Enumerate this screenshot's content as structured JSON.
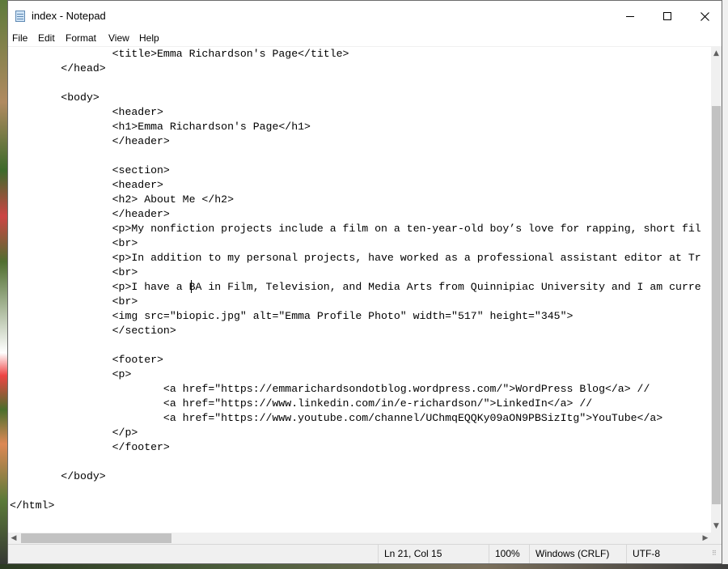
{
  "window": {
    "title": "index - Notepad"
  },
  "menu": [
    "File",
    "Edit",
    "Format",
    "View",
    "Help"
  ],
  "editor": {
    "lines": [
      "\t\t<title>Emma Richardson's Page</title>",
      "\t</head>",
      "",
      "\t<body>",
      "\t\t<header>",
      "\t\t<h1>Emma Richardson's Page</h1>",
      "\t\t</header>",
      "",
      "\t\t<section>",
      "\t\t<header>",
      "\t\t<h2> About Me </h2>",
      "\t\t</header>",
      "\t\t<p>My nonfiction projects include a film on a ten-year-old boy’s love for rapping, short fil",
      "\t\t<br>",
      "\t\t<p>In addition to my personal projects, have worked as a professional assistant editor at Tr",
      "\t\t<br>",
      "\t\t<p>I have a BA in Film, Television, and Media Arts from Quinnipiac University and I am curre",
      "\t\t<br>",
      "\t\t<img src=\"biopic.jpg\" alt=\"Emma Profile Photo\" width=\"517\" height=\"345\">",
      "\t\t</section>",
      "",
      "\t\t<footer>",
      "\t\t<p>",
      "\t\t\t<a href=\"https://emmarichardsondotblog.wordpress.com/\">WordPress Blog</a> //",
      "\t\t\t<a href=\"https://www.linkedin.com/in/e-richardson/\">LinkedIn</a> //",
      "\t\t\t<a href=\"https://www.youtube.com/channel/UChmqEQQKy09aON9PBSizItg\">YouTube</a>",
      "\t\t</p>",
      "\t\t</footer>",
      "",
      "\t</body>",
      "",
      "</html>"
    ]
  },
  "status": {
    "position": "Ln 21, Col 15",
    "zoom": "100%",
    "line_endings": "Windows (CRLF)",
    "encoding": "UTF-8"
  },
  "icons": {
    "app": "notepad-icon",
    "minimize": "minimize-icon",
    "maximize": "maximize-icon",
    "close": "close-icon"
  }
}
